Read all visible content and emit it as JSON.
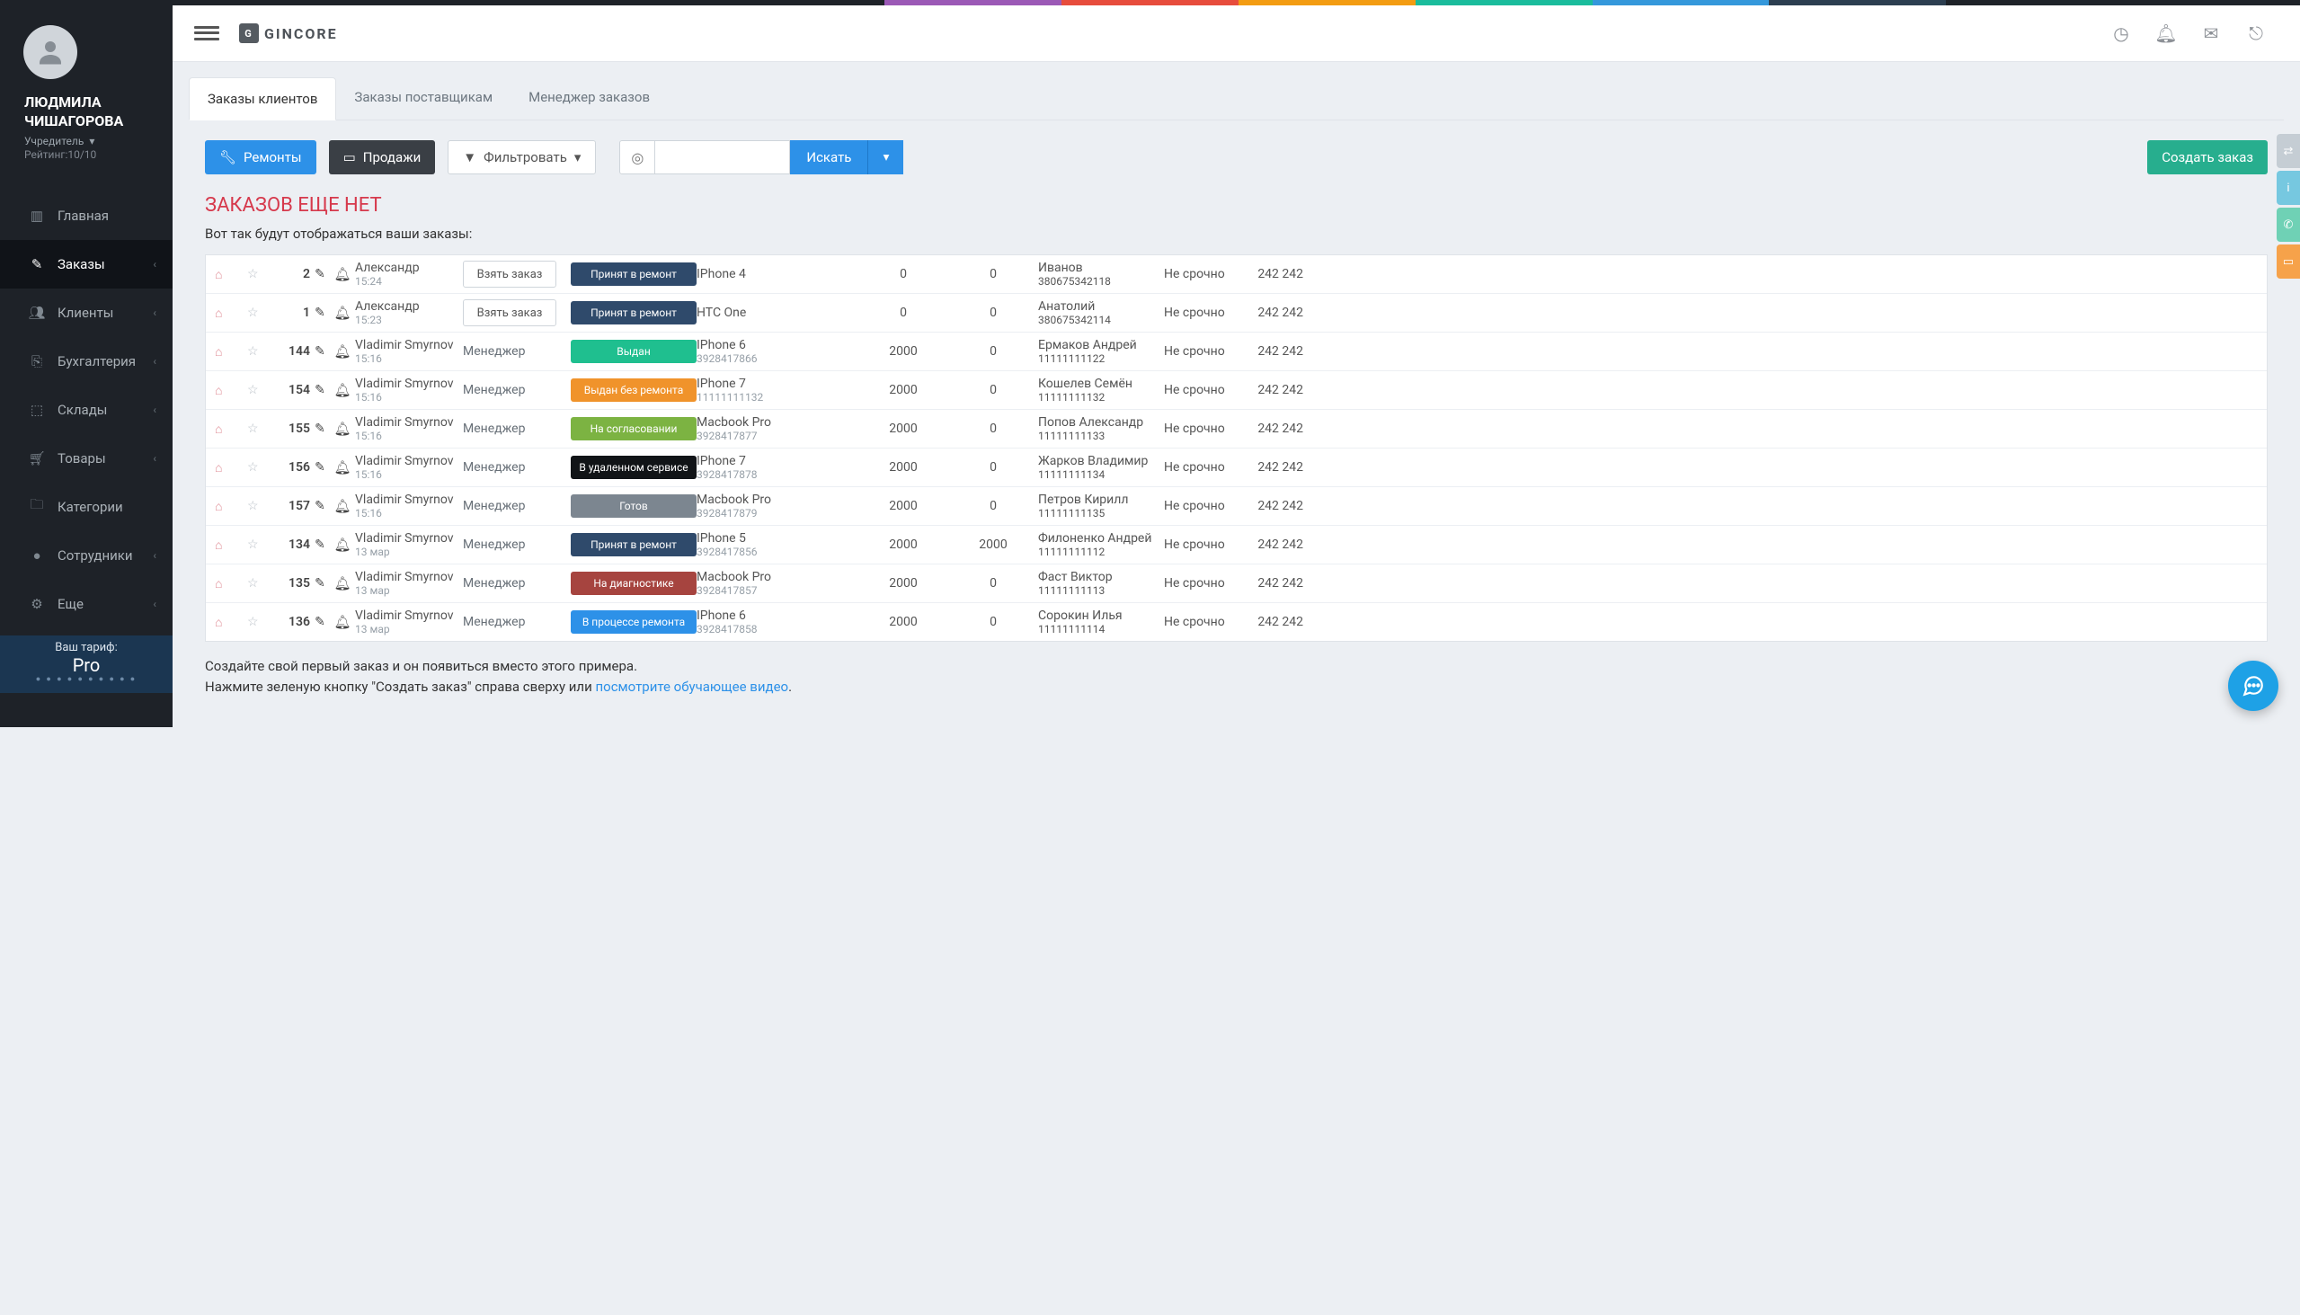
{
  "stripe": [
    "#1e2228",
    "#1e2228",
    "#1e2228",
    "#1e2228",
    "#1e2228",
    "#9b59b6",
    "#e74c3c",
    "#f39c12",
    "#1abc9c",
    "#3498db",
    "#2c3e50",
    "#1e2228",
    "#1e2228"
  ],
  "user": {
    "name_line1": "ЛЮДМИЛА",
    "name_line2": "ЧИШАГОРОВА",
    "role": "Учредитель",
    "rating": "Рейтинг:10/10"
  },
  "nav": [
    {
      "icon": "bar",
      "label": "Главная",
      "chev": false
    },
    {
      "icon": "edit",
      "label": "Заказы",
      "chev": true,
      "active": true
    },
    {
      "icon": "users",
      "label": "Клиенты",
      "chev": true
    },
    {
      "icon": "money",
      "label": "Бухгалтерия",
      "chev": true
    },
    {
      "icon": "box",
      "label": "Склады",
      "chev": true
    },
    {
      "icon": "cart",
      "label": "Товары",
      "chev": true
    },
    {
      "icon": "folder",
      "label": "Категории",
      "chev": false
    },
    {
      "icon": "user",
      "label": "Сотрудники",
      "chev": true
    },
    {
      "icon": "gear",
      "label": "Еще",
      "chev": true
    }
  ],
  "tariff": {
    "label": "Ваш тариф:",
    "plan": "Pro"
  },
  "topbar": {
    "logo": "GINCORE"
  },
  "tabs": [
    "Заказы клиентов",
    "Заказы поставщикам",
    "Менеджер заказов"
  ],
  "active_tab": 0,
  "buttons": {
    "repairs": "Ремонты",
    "sales": "Продажи",
    "filter": "Фильтровать",
    "search": "Искать",
    "create": "Создать заказ",
    "take": "Взять заказ",
    "manager": "Менеджер"
  },
  "no_results": "ЗАКАЗОВ ЕЩЕ НЕТ",
  "sub": "Вот так будут отображаться ваши заказы:",
  "statuses": {
    "accept": {
      "t": "Принят в ремонт",
      "c": "#2f4a6b"
    },
    "issued": {
      "t": "Выдан",
      "c": "#1fbf8f"
    },
    "issued_no": {
      "t": "Выдан без ремонта",
      "c": "#f0932b"
    },
    "agree": {
      "t": "На согласовании",
      "c": "#7cb342"
    },
    "remote": {
      "t": "В удаленном сервисе",
      "c": "#111417"
    },
    "ready": {
      "t": "Готов",
      "c": "#7c8690"
    },
    "diag": {
      "t": "На диагностике",
      "c": "#a6443f"
    },
    "inprog": {
      "t": "В процессе ремонта",
      "c": "#2d91e8"
    }
  },
  "urgency": "Не срочно",
  "price": "242 242",
  "rows": [
    {
      "id": "2",
      "who": "Александр",
      "time": "15:24",
      "take": true,
      "status": "accept",
      "dev": "IPhone 4",
      "devn": "",
      "n1": "0",
      "n2": "0",
      "cli": "Иванов",
      "clip": "380675342118"
    },
    {
      "id": "1",
      "who": "Александр",
      "time": "15:23",
      "take": true,
      "status": "accept",
      "dev": "HTC One",
      "devn": "",
      "n1": "0",
      "n2": "0",
      "cli": "Анатолий",
      "clip": "380675342114"
    },
    {
      "id": "144",
      "who": "Vladimir Smyrnov",
      "time": "15:16",
      "take": false,
      "status": "issued",
      "dev": "IPhone 6",
      "devn": "3928417866",
      "n1": "2000",
      "n2": "0",
      "cli": "Ермаков Андрей",
      "clip": "11111111122"
    },
    {
      "id": "154",
      "who": "Vladimir Smyrnov",
      "time": "15:16",
      "take": false,
      "status": "issued_no",
      "dev": "IPhone 7",
      "devn": "11111111132",
      "n1": "2000",
      "n2": "0",
      "cli": "Кошелев Семён",
      "clip": "11111111132"
    },
    {
      "id": "155",
      "who": "Vladimir Smyrnov",
      "time": "15:16",
      "take": false,
      "status": "agree",
      "dev": "Macbook Pro",
      "devn": "3928417877",
      "n1": "2000",
      "n2": "0",
      "cli": "Попов Александр",
      "clip": "11111111133"
    },
    {
      "id": "156",
      "who": "Vladimir Smyrnov",
      "time": "15:16",
      "take": false,
      "status": "remote",
      "dev": "IPhone 7",
      "devn": "3928417878",
      "n1": "2000",
      "n2": "0",
      "cli": "Жарков Владимир",
      "clip": "11111111134"
    },
    {
      "id": "157",
      "who": "Vladimir Smyrnov",
      "time": "15:16",
      "take": false,
      "status": "ready",
      "dev": "Macbook Pro",
      "devn": "3928417879",
      "n1": "2000",
      "n2": "0",
      "cli": "Петров Кирилл",
      "clip": "11111111135"
    },
    {
      "id": "134",
      "who": "Vladimir Smyrnov",
      "time": "13 мар",
      "take": false,
      "status": "accept",
      "dev": "IPhone 5",
      "devn": "3928417856",
      "n1": "2000",
      "n2": "2000",
      "cli": "Филоненко Андрей",
      "clip": "11111111112"
    },
    {
      "id": "135",
      "who": "Vladimir Smyrnov",
      "time": "13 мар",
      "take": false,
      "status": "diag",
      "dev": "Macbook Pro",
      "devn": "3928417857",
      "n1": "2000",
      "n2": "0",
      "cli": "Фаст Виктор",
      "clip": "11111111113"
    },
    {
      "id": "136",
      "who": "Vladimir Smyrnov",
      "time": "13 мар",
      "take": false,
      "status": "inprog",
      "dev": "IPhone 6",
      "devn": "3928417858",
      "n1": "2000",
      "n2": "0",
      "cli": "Сорокин Илья",
      "clip": "11111111114"
    }
  ],
  "footer": {
    "l1": "Создайте свой первый заказ и он появиться вместо этого примера.",
    "l2_a": "Нажмите зеленую кнопку \"Создать заказ\" справа сверху или ",
    "link": "посмотрите обучающее видео",
    "l2_b": "."
  },
  "side_tabs": [
    {
      "c": "#c5cdd4",
      "i": "⇄"
    },
    {
      "c": "#76c8e0",
      "i": "i"
    },
    {
      "c": "#6fd1b5",
      "i": "✆"
    },
    {
      "c": "#f6a24a",
      "i": "▭"
    }
  ]
}
